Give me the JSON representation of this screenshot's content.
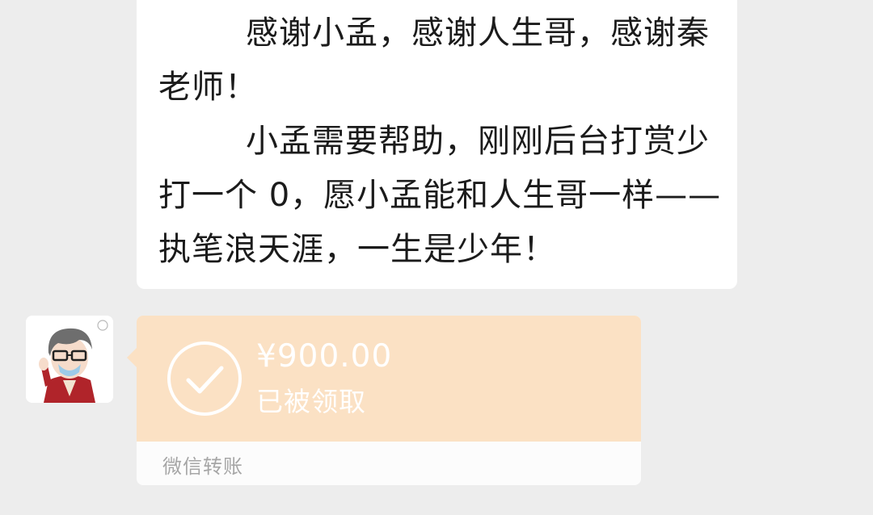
{
  "message": {
    "paragraphs": [
      "感谢小孟，感谢人生哥，感谢秦老师！",
      "小孟需要帮助，刚刚后台打赏少打一个 0，愿小孟能和人生哥一样——执笔浪天涯，一生是少年！"
    ]
  },
  "transfer": {
    "amount": "¥900.00",
    "status": "已被领取",
    "footer": "微信转账",
    "icon": "check-circle-icon",
    "card_color": "#fbe1c4"
  },
  "avatar": {
    "icon": "cartoon-man-avatar"
  }
}
